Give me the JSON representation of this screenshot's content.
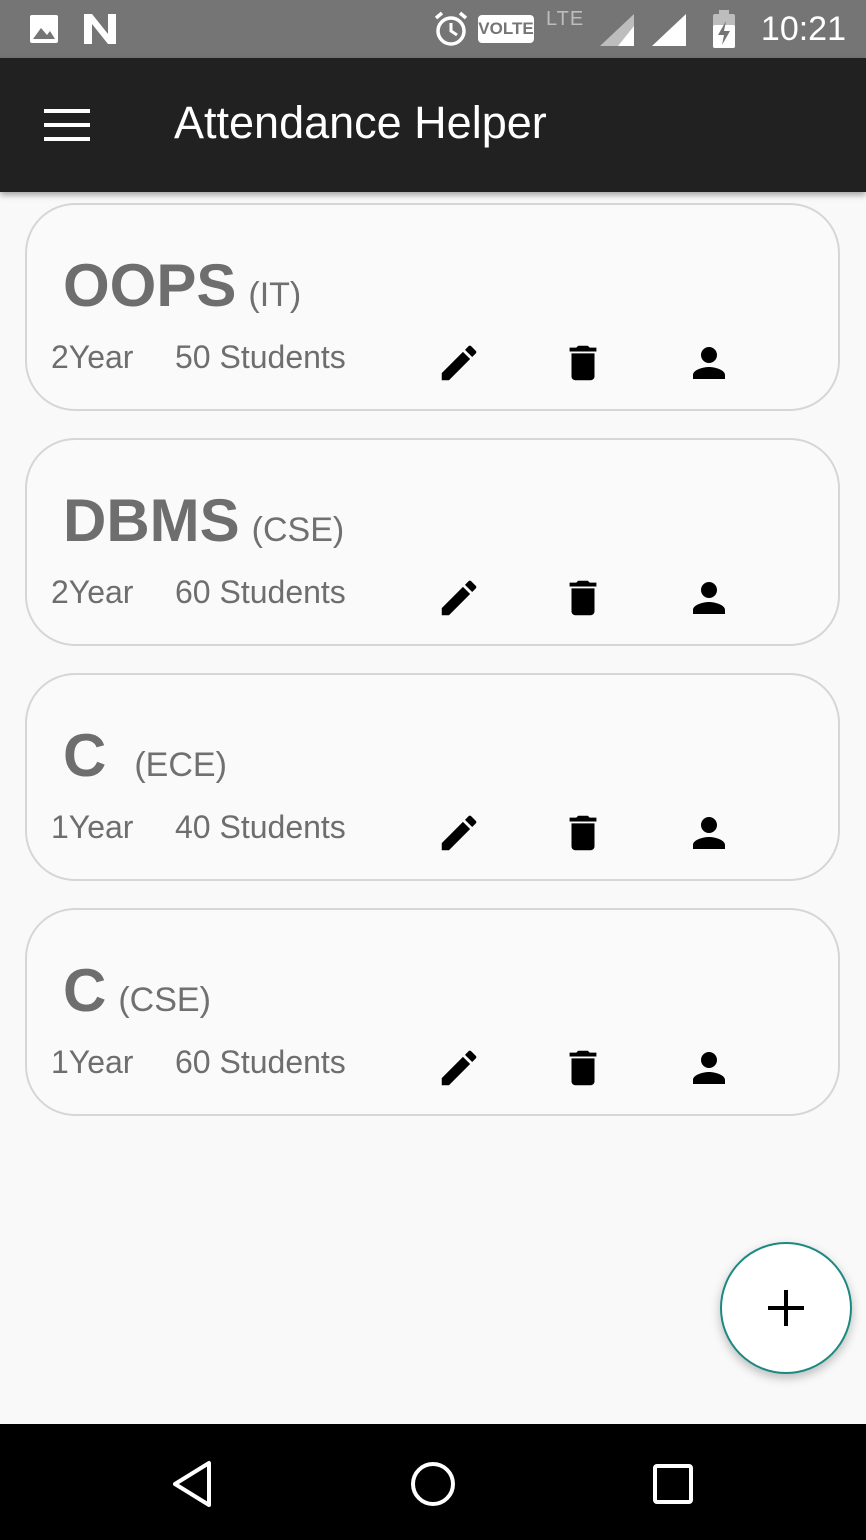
{
  "status_bar": {
    "time": "10:21",
    "volte_label": "VOLTE",
    "lte_label": "LTE",
    "icons": [
      "image-icon",
      "n-logo-icon",
      "alarm-icon",
      "volte-icon",
      "lte-icon",
      "signal-icon",
      "signal-icon",
      "battery-charging-icon"
    ]
  },
  "app_bar": {
    "title": "Attendance Helper",
    "menu_icon": "hamburger-menu-icon"
  },
  "classes": [
    {
      "subject": "OOPS",
      "branch": "(IT)",
      "year": "2Year",
      "students": "50 Students"
    },
    {
      "subject": "DBMS",
      "branch": "(CSE)",
      "year": "2Year",
      "students": "60 Students"
    },
    {
      "subject": "C",
      "branch": "(ECE)",
      "year": "1Year",
      "students": "40 Students"
    },
    {
      "subject": "C",
      "branch": "(CSE)",
      "year": "1Year",
      "students": "60 Students"
    }
  ],
  "card_actions": [
    "edit-icon",
    "delete-icon",
    "person-icon"
  ],
  "fab": {
    "icon": "plus-icon",
    "accent_color": "#1a8a80"
  },
  "nav_bar": {
    "icons": [
      "back-icon",
      "home-icon",
      "recents-icon"
    ]
  },
  "colors": {
    "app_bar": "#212121",
    "status_bar": "#757575",
    "background": "#f9f9f9"
  }
}
